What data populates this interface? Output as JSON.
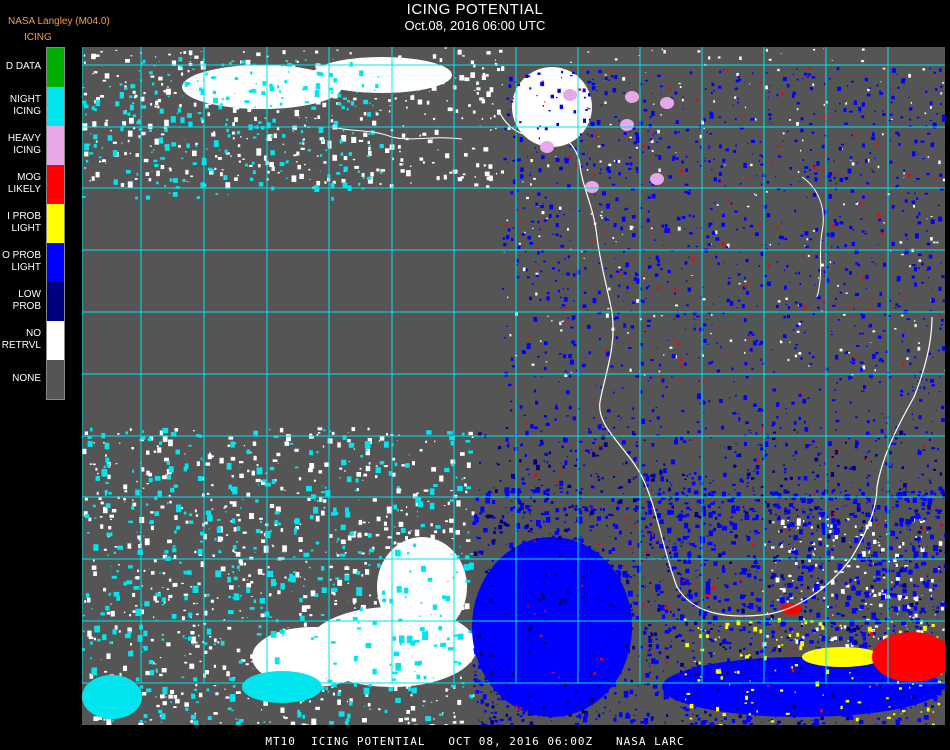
{
  "header": {
    "title": "ICING POTENTIAL",
    "subtitle": "Oct.08, 2016 06:00 UTC",
    "provider": "NASA Langley (M04.0)"
  },
  "legend": {
    "title": "ICING",
    "items": [
      {
        "lines": [
          "D DATA"
        ],
        "color": "#00b000"
      },
      {
        "lines": [
          "NIGHT",
          "ICING"
        ],
        "color": "#00e5ee"
      },
      {
        "lines": [
          "HEAVY",
          "ICING"
        ],
        "color": "#e8a8e8"
      },
      {
        "lines": [
          "MOG",
          "LIKELY"
        ],
        "color": "#ff0000"
      },
      {
        "lines": [
          "I PROB",
          "LIGHT"
        ],
        "color": "#ffff00"
      },
      {
        "lines": [
          "O PROB",
          "LIGHT"
        ],
        "color": "#0000ff"
      },
      {
        "lines": [
          "LOW",
          "PROB"
        ],
        "color": "#000080"
      },
      {
        "lines": [
          "NO",
          "RETRVL"
        ],
        "color": "#ffffff"
      },
      {
        "lines": [
          "NONE"
        ],
        "color": "#555555"
      }
    ]
  },
  "map": {
    "background": "#555555",
    "grid_color": "#00e5ee",
    "label_color": "#d02020",
    "coast_color": "#ffffff"
  },
  "footer": {
    "text": "MT10  ICING POTENTIAL   OCT 08, 2016 06:00Z   NASA LARC"
  }
}
